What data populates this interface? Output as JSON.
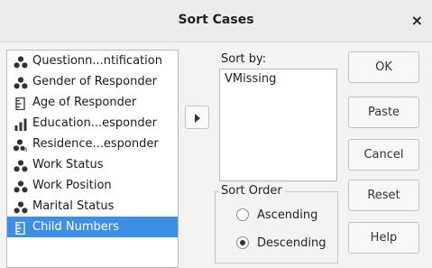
{
  "dialog": {
    "title": "Sort Cases",
    "close_glyph": "×"
  },
  "variables": [
    {
      "label": "Questionn...ntification",
      "icon": "nominal-icon",
      "selected": false
    },
    {
      "label": "Gender of Responder",
      "icon": "nominal-icon",
      "selected": false
    },
    {
      "label": "Age of Responder",
      "icon": "ruler-icon",
      "selected": false
    },
    {
      "label": "Education...esponder",
      "icon": "ordinal-icon",
      "selected": false
    },
    {
      "label": "Residence...esponder",
      "icon": "nominal-string-icon",
      "selected": false
    },
    {
      "label": "Work Status",
      "icon": "nominal-icon",
      "selected": false
    },
    {
      "label": "Work Position",
      "icon": "nominal-icon",
      "selected": false
    },
    {
      "label": "Marital Status",
      "icon": "nominal-icon",
      "selected": false
    },
    {
      "label": "Child Numbers",
      "icon": "ruler-icon",
      "selected": true
    }
  ],
  "sort_by": {
    "label": "Sort by:",
    "items": [
      "VMissing"
    ]
  },
  "sort_order": {
    "label": "Sort Order",
    "ascending_label": "Ascending",
    "descending_label": "Descending",
    "selected": "descending"
  },
  "buttons": {
    "ok": "OK",
    "paste": "Paste",
    "cancel": "Cancel",
    "reset": "Reset",
    "help": "Help"
  },
  "colors": {
    "selection": "#3d8fe3",
    "dialog_bg": "#f3f3f3"
  }
}
